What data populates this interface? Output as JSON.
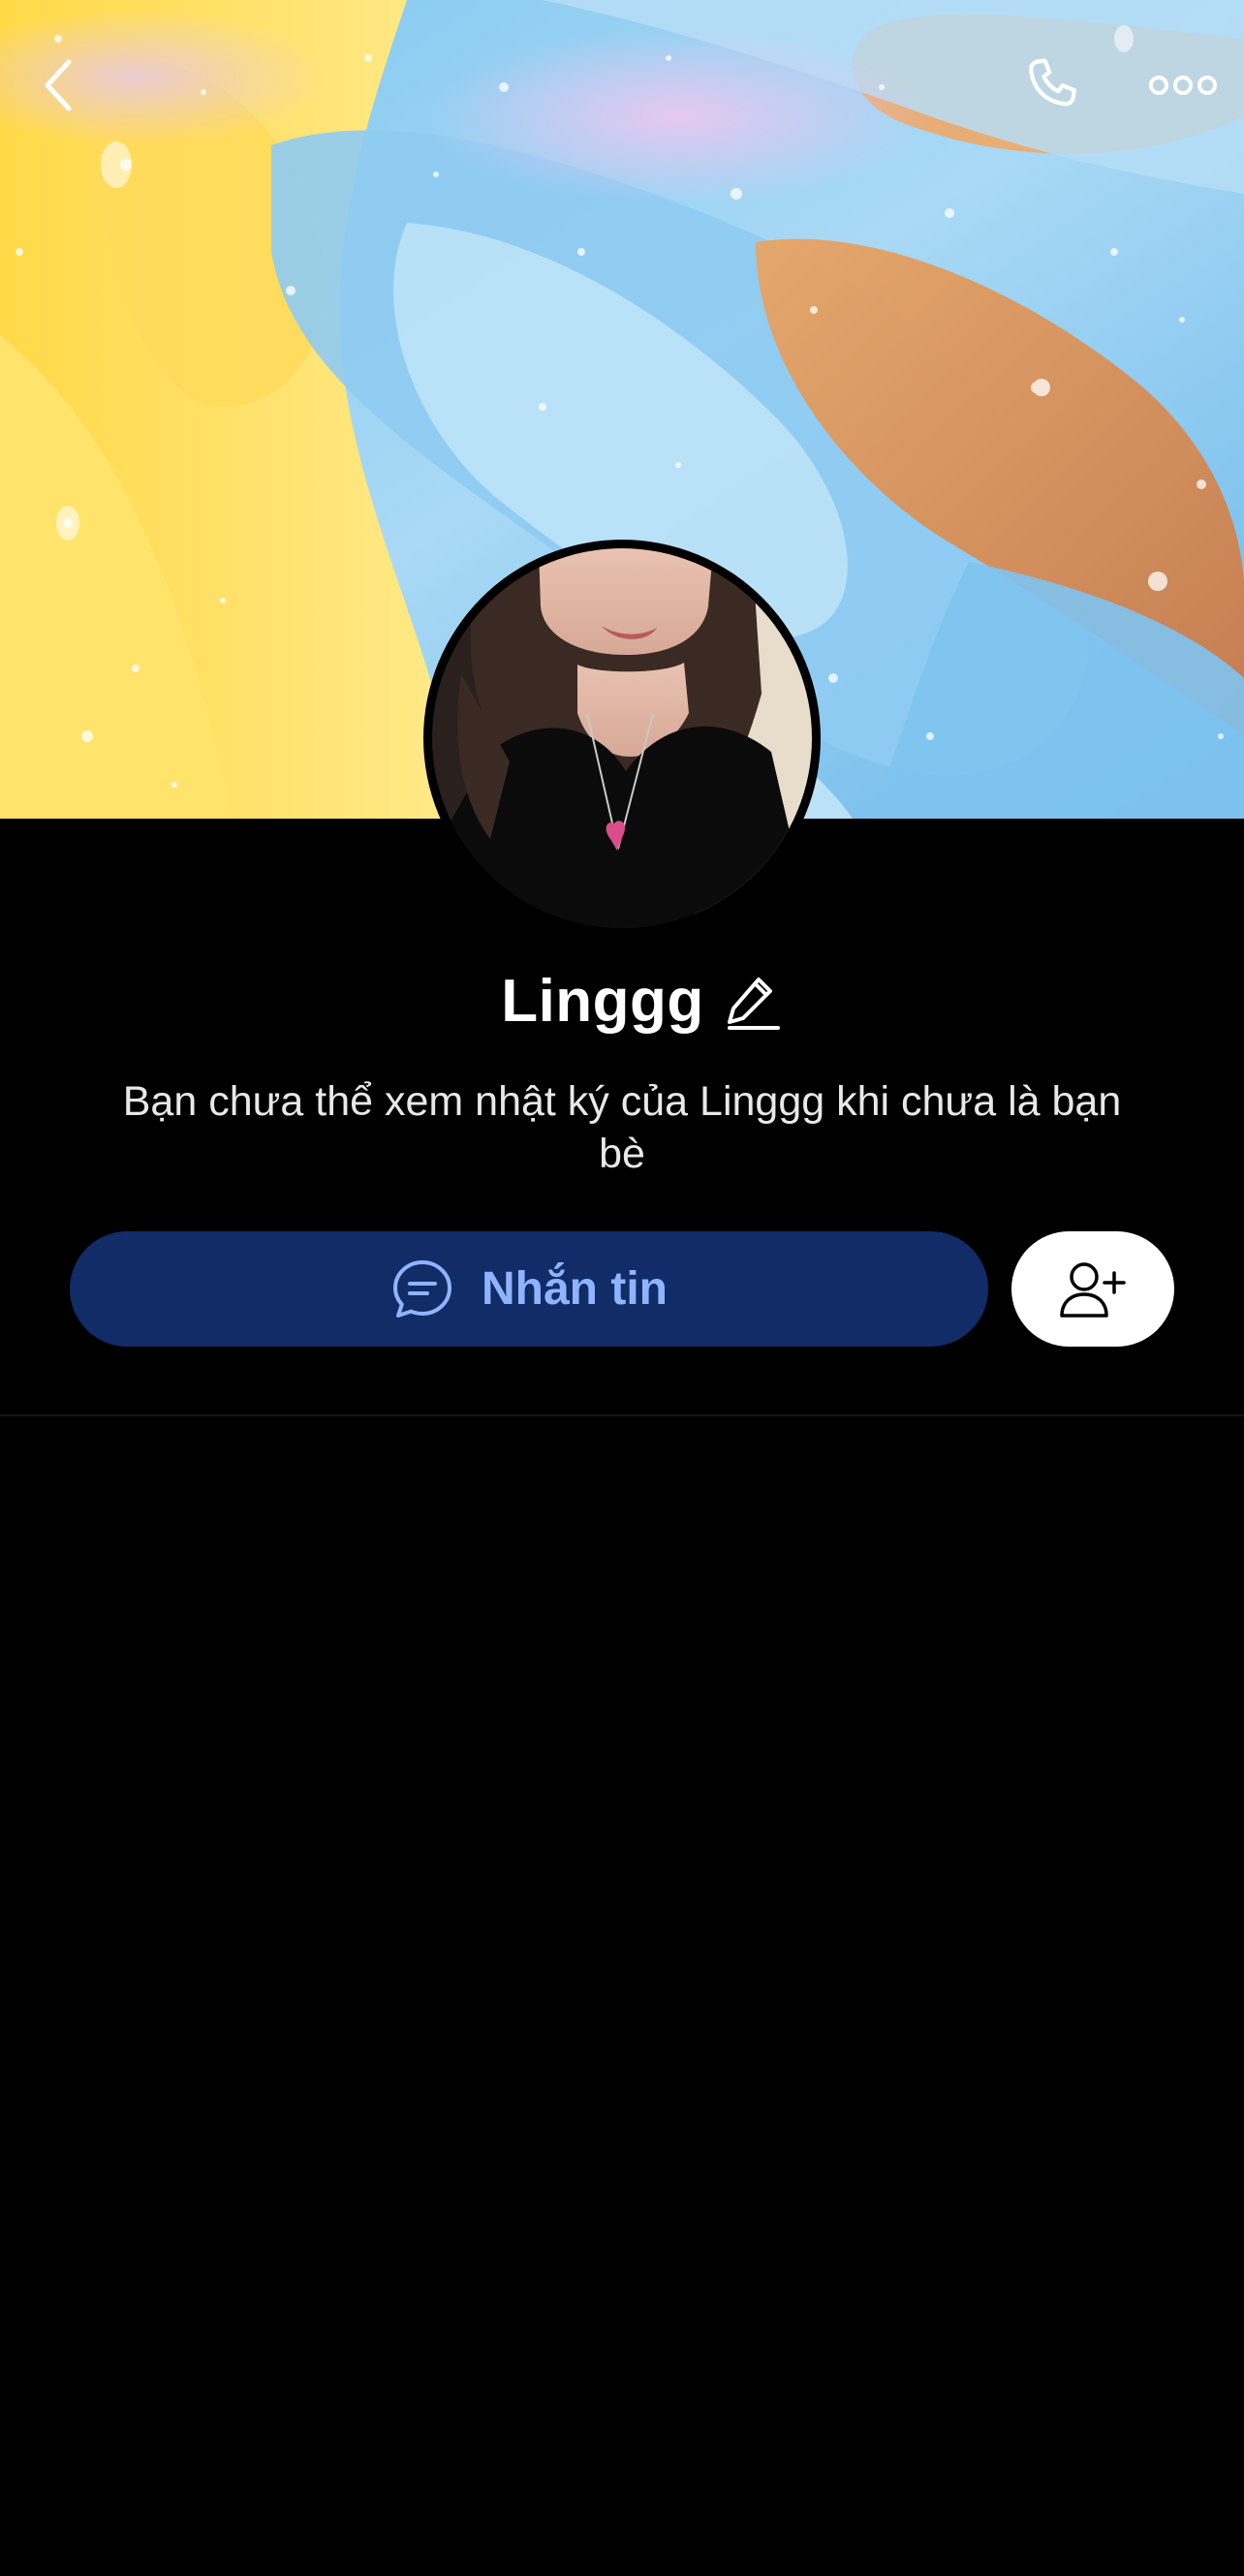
{
  "profile": {
    "name": "Linggg",
    "notice": "Bạn chưa thể xem nhật ký của Linggg khi chưa là bạn bè"
  },
  "actions": {
    "message_label": "Nhắn tin"
  },
  "icons": {
    "back": "chevron-left-icon",
    "call": "phone-icon",
    "more": "more-dots-icon",
    "edit": "pencil-icon",
    "message": "chat-bubble-icon",
    "add_friend": "add-friend-icon"
  },
  "colors": {
    "background": "#000000",
    "message_button_bg": "#112c66",
    "message_button_text": "#8fb4ff",
    "add_button_bg": "#ffffff"
  }
}
